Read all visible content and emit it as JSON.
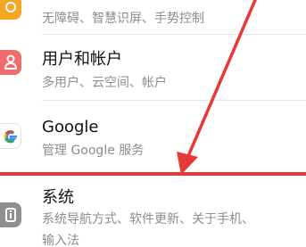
{
  "settings_list": {
    "items": [
      {
        "title": "",
        "subtitle": "无障碍、智慧识屏、手势控制",
        "icon": "accessibility-icon",
        "icon_color": "#f5a623"
      },
      {
        "title": "用户和帐户",
        "subtitle": "多用户、云空间、帐户",
        "icon": "user-account-icon",
        "icon_color": "#f06b6b"
      },
      {
        "title": "Google",
        "subtitle": "管理 Google 服务",
        "icon": "google-icon",
        "icon_color": "#ffffff"
      },
      {
        "title": "系统",
        "subtitle": "系统导航方式、软件更新、关于手机、",
        "subtitle_line2": "输入法",
        "icon": "system-info-icon",
        "icon_color": "#8f8f8f"
      }
    ]
  },
  "annotation": {
    "color": "#e53935"
  }
}
